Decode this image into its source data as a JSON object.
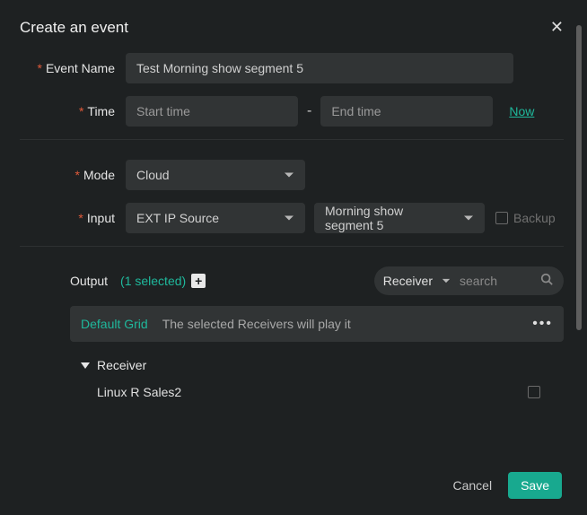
{
  "title": "Create an event",
  "labels": {
    "event_name": "Event Name",
    "time": "Time",
    "mode": "Mode",
    "input": "Input",
    "output": "Output",
    "backup": "Backup"
  },
  "fields": {
    "event_name_value": "Test Morning show segment 5",
    "start_placeholder": "Start time",
    "end_placeholder": "End time",
    "time_dash": "-",
    "now_link": "Now",
    "mode_value": "Cloud",
    "input_source_value": "EXT IP Source",
    "input_segment_value": "Morning show segment 5"
  },
  "output": {
    "count_text": "(1 selected)",
    "receiver_dd": "Receiver",
    "search_placeholder": "search",
    "grid_name": "Default Grid",
    "grid_desc": "The selected Receivers will play it",
    "more": "•••",
    "tree": {
      "node": "Receiver",
      "child": "Linux R Sales2"
    }
  },
  "footer": {
    "cancel": "Cancel",
    "save": "Save"
  }
}
